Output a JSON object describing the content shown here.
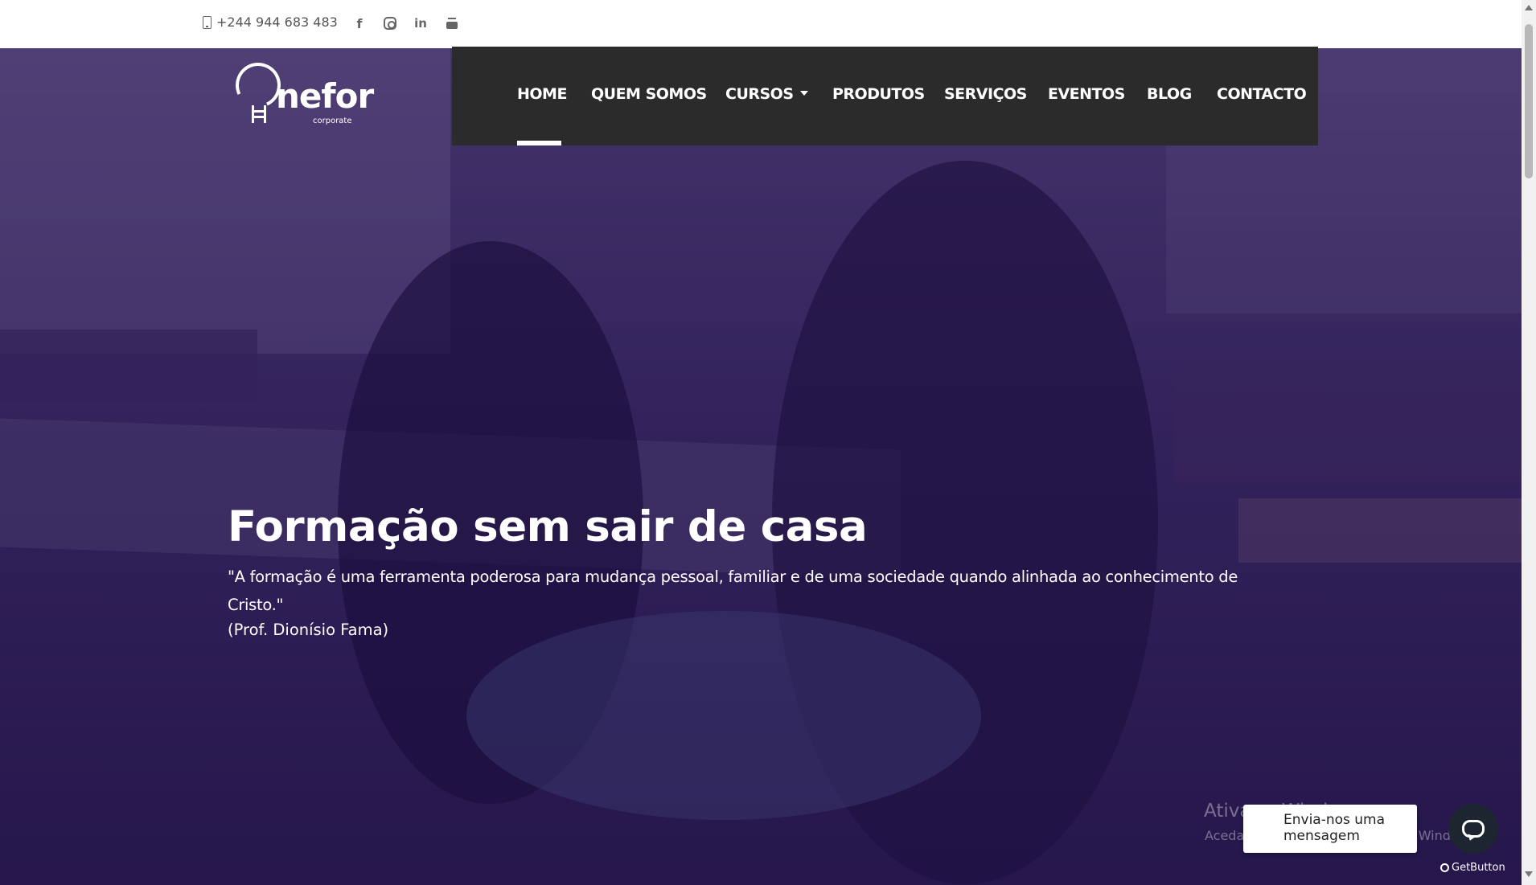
{
  "topbar": {
    "phone": "+244 944 683 483",
    "social": [
      {
        "icon": "facebook-icon",
        "glyph": "f"
      },
      {
        "icon": "instagram-icon",
        "glyph": ""
      },
      {
        "icon": "linkedin-icon",
        "glyph": "in"
      },
      {
        "icon": "youtube-icon",
        "glyph": ""
      }
    ]
  },
  "logo": {
    "wordmark": "nefor",
    "subtitle": "corporate"
  },
  "nav": {
    "items": [
      {
        "label": "HOME",
        "active": true
      },
      {
        "label": "QUEM SOMOS"
      },
      {
        "label": "CURSOS",
        "dropdown": true
      },
      {
        "label": "PRODUTOS"
      },
      {
        "label": "SERVIÇOS"
      },
      {
        "label": "EVENTOS"
      },
      {
        "label": "BLOG"
      },
      {
        "label": "CONTACTO"
      }
    ]
  },
  "hero": {
    "title": "Formação sem sair de casa",
    "quote": "\"A formação é uma ferramenta poderosa para mudança pessoal, familiar e de uma sociedade quando alinhada ao conhecimento de Cristo.\"",
    "author": "(Prof. Dionísio Fama)"
  },
  "watermark": {
    "line1": "Ativar o Windows",
    "line2": "Aceda a Definições para ativar o Windows."
  },
  "chat": {
    "message": "Envia-nos uma mensagem",
    "brand": "GetButton"
  },
  "colors": {
    "nav_background": "#2b2b2b",
    "hero_overlay": "#3c2f5e",
    "chat_button": "#1d2530"
  }
}
